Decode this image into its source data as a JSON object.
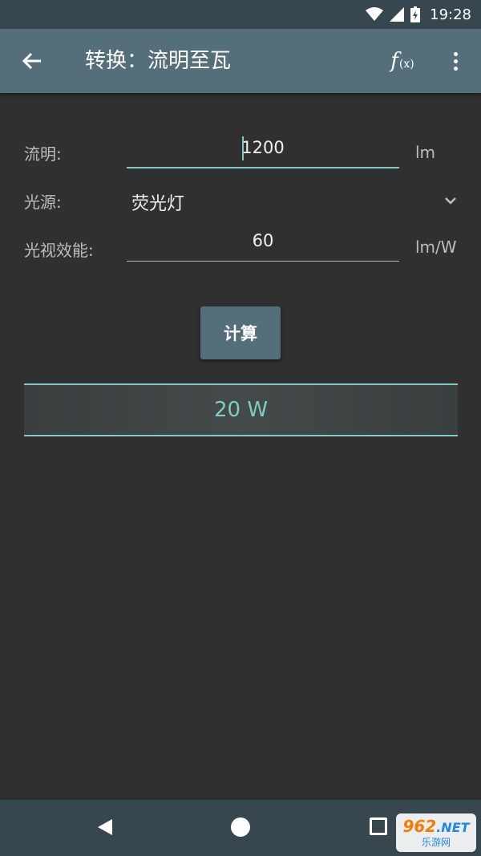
{
  "status_bar": {
    "time": "19:28"
  },
  "app_bar": {
    "title": "转换：流明至瓦"
  },
  "form": {
    "lumen": {
      "label": "流明:",
      "value": "1200",
      "unit": "lm"
    },
    "source": {
      "label": "光源:",
      "value": "荧光灯"
    },
    "efficacy": {
      "label": "光视效能:",
      "value": "60",
      "unit": "lm/W"
    }
  },
  "calculate_label": "计算",
  "result": "20 W",
  "watermark": {
    "brand": "962",
    "suffix": ".NET",
    "subtitle": "乐游网"
  }
}
